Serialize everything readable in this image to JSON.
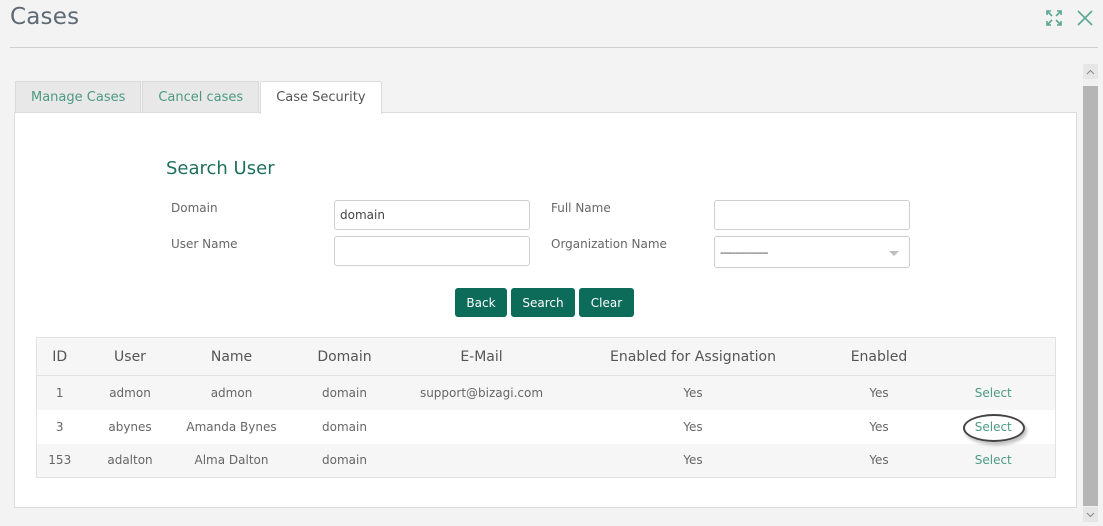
{
  "window": {
    "title": "Cases",
    "icons": {
      "expand": "expand-icon",
      "close": "close-icon"
    }
  },
  "tabs": [
    {
      "label": "Manage Cases",
      "active": false
    },
    {
      "label": "Cancel cases",
      "active": false
    },
    {
      "label": "Case Security",
      "active": true
    }
  ],
  "search": {
    "title": "Search User",
    "fields": {
      "domain": {
        "label": "Domain",
        "value": "domain",
        "placeholder": ""
      },
      "full_name": {
        "label": "Full Name",
        "value": "",
        "placeholder": ""
      },
      "user_name": {
        "label": "User Name",
        "value": "",
        "placeholder": ""
      },
      "organization_name": {
        "label": "Organization Name",
        "selected": "----------------"
      }
    },
    "buttons": {
      "back": "Back",
      "search": "Search",
      "clear": "Clear"
    }
  },
  "table": {
    "columns": [
      "ID",
      "User",
      "Name",
      "Domain",
      "E-Mail",
      "Enabled for Assignation",
      "Enabled",
      ""
    ],
    "rows": [
      {
        "id": "1",
        "user": "admon",
        "name": "admon",
        "domain": "domain",
        "email": "support@bizagi.com",
        "assignation": "Yes",
        "enabled": "Yes",
        "action": "Select"
      },
      {
        "id": "3",
        "user": "abynes",
        "name": "Amanda Bynes",
        "domain": "domain",
        "email": "",
        "assignation": "Yes",
        "enabled": "Yes",
        "action": "Select",
        "highlighted": true
      },
      {
        "id": "153",
        "user": "adalton",
        "name": "Alma Dalton",
        "domain": "domain",
        "email": "",
        "assignation": "Yes",
        "enabled": "Yes",
        "action": "Select"
      }
    ]
  },
  "colors": {
    "accent": "#0d6b59",
    "link": "#4d9a83",
    "title": "#1f6f5e"
  }
}
